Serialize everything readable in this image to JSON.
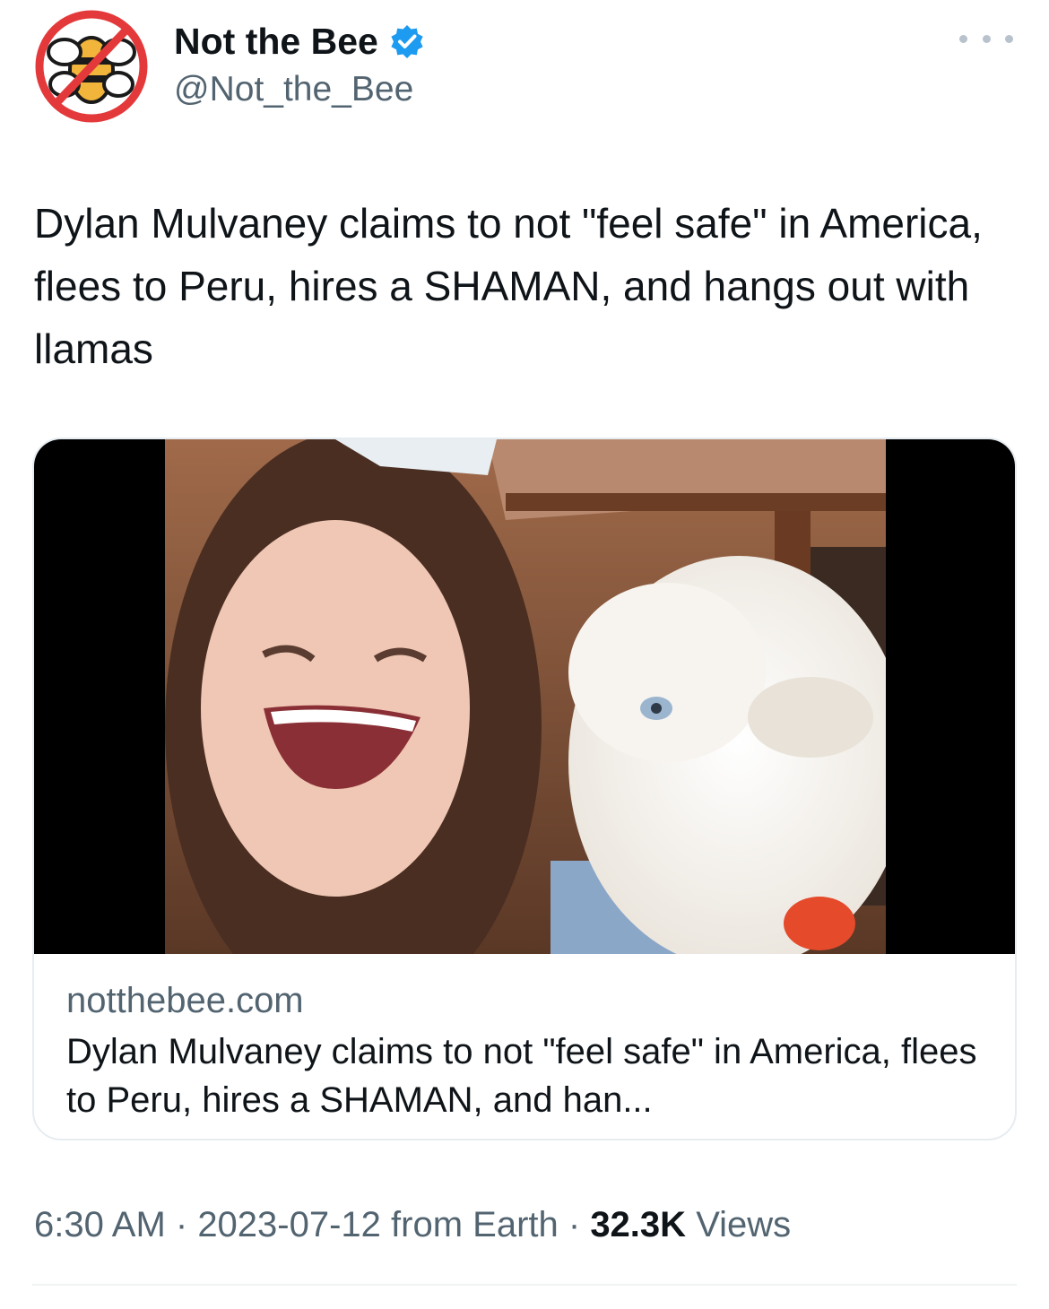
{
  "author": {
    "display_name": "Not the Bee",
    "handle": "@Not_the_Bee",
    "verified_icon": "verified-badge-icon",
    "avatar_icon": "not-the-bee-logo"
  },
  "more_icon": "more-options-icon",
  "tweet": {
    "text": "Dylan Mulvaney claims to not \"feel safe\" in America, flees to Peru, hires a SHAMAN, and hangs out with llamas"
  },
  "card": {
    "image_description": "person smiling next to a white alpaca",
    "domain": "notthebee.com",
    "title": "Dylan Mulvaney claims to not \"feel safe\" in America, flees to Peru, hires a SHAMAN, and han..."
  },
  "footer": {
    "time": "6:30 AM",
    "separator": " · ",
    "date": "2023-07-12",
    "source": "from Earth",
    "views_count": "32.3K",
    "views_label": "Views"
  },
  "colors": {
    "text_primary": "#0f1419",
    "text_secondary": "#536471",
    "verified_blue": "#1d9bf0",
    "border": "#e6ecf0"
  }
}
